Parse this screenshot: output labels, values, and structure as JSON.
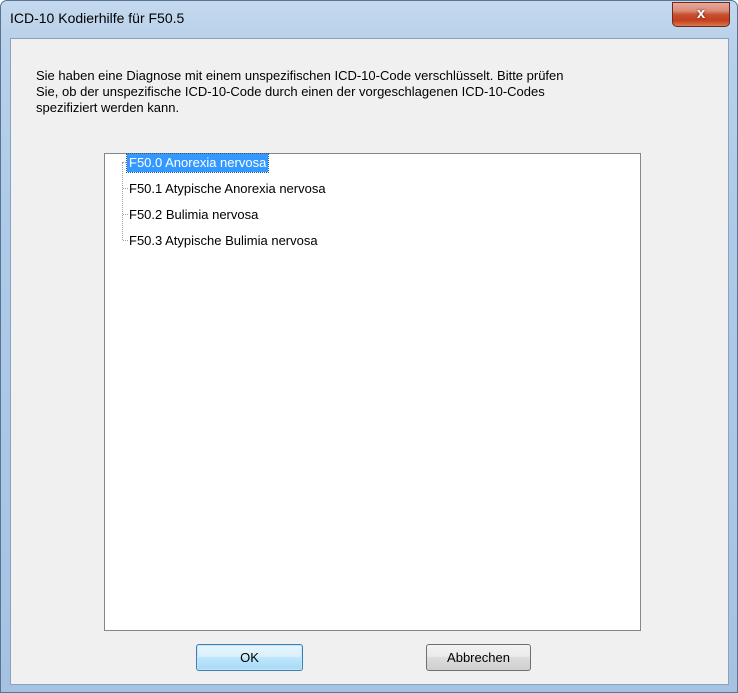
{
  "window": {
    "title": "ICD-10 Kodierhilfe für F50.5",
    "close_glyph": "x"
  },
  "message": {
    "line1": "Sie haben eine Diagnose mit einem unspezifischen ICD-10-Code verschlüsselt. Bitte prüfen",
    "line2": "Sie, ob der unspezifische ICD-10-Code durch einen der vorgeschlagenen ICD-10-Codes",
    "line3": "spezifiziert werden kann."
  },
  "tree": {
    "items": [
      {
        "label": "F50.0 Anorexia nervosa",
        "selected": true
      },
      {
        "label": "F50.1 Atypische Anorexia nervosa",
        "selected": false
      },
      {
        "label": "F50.2 Bulimia nervosa",
        "selected": false
      },
      {
        "label": "F50.3 Atypische Bulimia nervosa",
        "selected": false
      }
    ]
  },
  "buttons": {
    "ok_label": "OK",
    "cancel_label": "Abbrechen"
  },
  "colors": {
    "selection": "#3399ff",
    "close_button": "#c43f1f"
  }
}
